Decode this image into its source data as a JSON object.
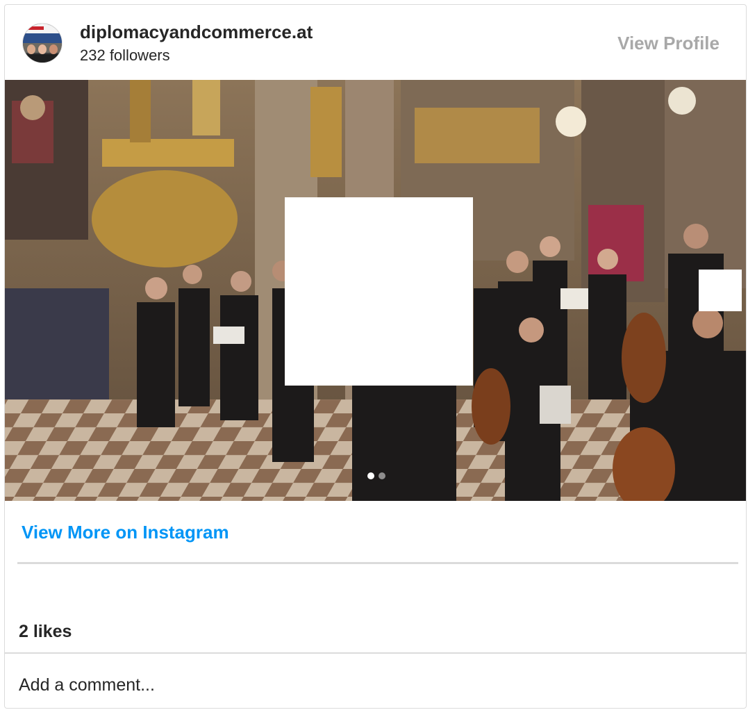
{
  "header": {
    "username": "diplomacyandcommerce.at",
    "followers": "232 followers",
    "view_profile": "View Profile"
  },
  "media": {
    "carousel_dots": 2,
    "active_index": 0
  },
  "footer": {
    "view_more": "View More on Instagram",
    "likes": "2 likes",
    "comment_placeholder": "Add a comment..."
  },
  "colors": {
    "link_blue": "#0095f6",
    "muted_gray": "#a8a8a8",
    "divider": "#dbdbdb",
    "text": "#262626"
  },
  "icons": {
    "avatar": "profile-avatar-icon"
  }
}
